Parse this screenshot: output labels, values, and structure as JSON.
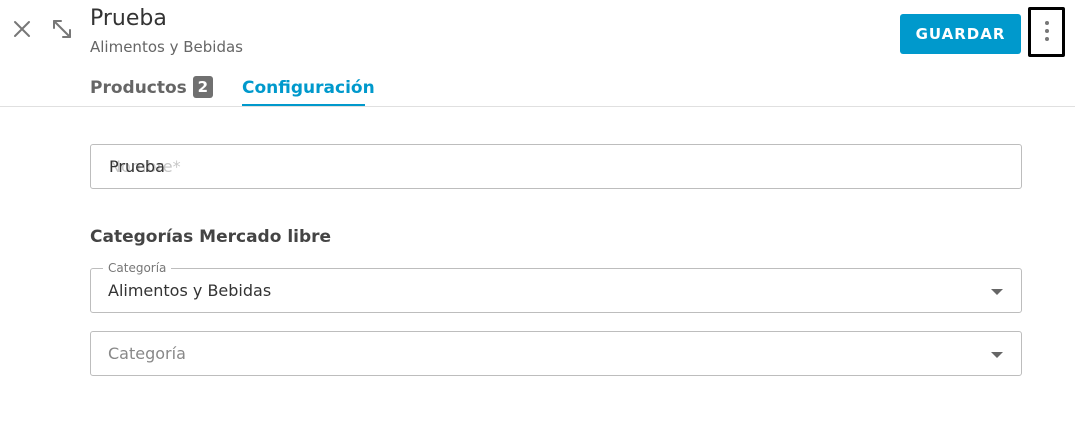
{
  "header": {
    "title": "Prueba",
    "subtitle": "Alimentos y Bebidas",
    "save_label": "GUARDAR",
    "icons": {
      "close": "close-icon",
      "expand": "expand-icon",
      "more": "more-vert-icon"
    }
  },
  "tabs": [
    {
      "label": "Productos",
      "badge": "2",
      "active": false
    },
    {
      "label": "Configuración",
      "active": true
    }
  ],
  "form": {
    "name": {
      "value": "Prueba",
      "label": "Nombre*"
    },
    "section_title": "Categorías Mercado libre",
    "category_1": {
      "label": "Categoría",
      "value": "Alimentos y Bebidas"
    },
    "category_2": {
      "placeholder": "Categoría"
    }
  },
  "colors": {
    "accent": "#0099cc",
    "badge": "#707070",
    "border": "#bdbdbd"
  }
}
